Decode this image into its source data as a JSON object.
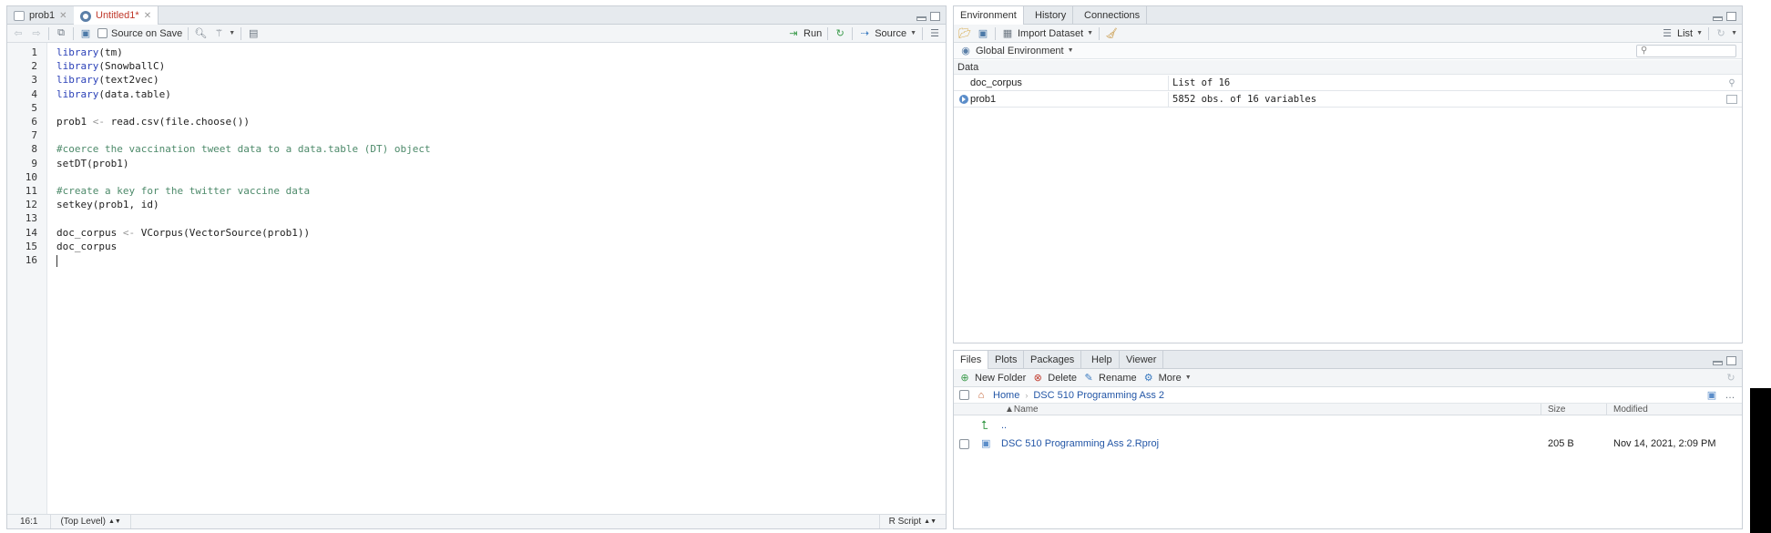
{
  "source": {
    "tabs": [
      {
        "label": "prob1",
        "modified": false
      },
      {
        "label": "Untitled1*",
        "modified": true
      }
    ],
    "toolbar": {
      "source_on_save": "Source on Save",
      "run": "Run",
      "source": "Source"
    },
    "lines": [
      {
        "num": "1",
        "parts": [
          {
            "t": "library",
            "c": "kw"
          },
          {
            "t": "(tm)",
            "c": ""
          }
        ]
      },
      {
        "num": "2",
        "parts": [
          {
            "t": "library",
            "c": "kw"
          },
          {
            "t": "(SnowballC)",
            "c": ""
          }
        ]
      },
      {
        "num": "3",
        "parts": [
          {
            "t": "library",
            "c": "kw"
          },
          {
            "t": "(text2vec)",
            "c": ""
          }
        ]
      },
      {
        "num": "4",
        "parts": [
          {
            "t": "library",
            "c": "kw"
          },
          {
            "t": "(data.table)",
            "c": ""
          }
        ]
      },
      {
        "num": "5",
        "parts": []
      },
      {
        "num": "6",
        "parts": [
          {
            "t": "prob1 ",
            "c": ""
          },
          {
            "t": "<-",
            "c": "op"
          },
          {
            "t": " read.csv(file.choose())",
            "c": ""
          }
        ]
      },
      {
        "num": "7",
        "parts": []
      },
      {
        "num": "8",
        "parts": [
          {
            "t": "#coerce the vaccination tweet data to a data.table (DT) object",
            "c": "cm"
          }
        ]
      },
      {
        "num": "9",
        "parts": [
          {
            "t": "setDT(prob1)",
            "c": ""
          }
        ]
      },
      {
        "num": "10",
        "parts": []
      },
      {
        "num": "11",
        "parts": [
          {
            "t": "#create a key for the twitter vaccine data",
            "c": "cm"
          }
        ]
      },
      {
        "num": "12",
        "parts": [
          {
            "t": "setkey(prob1, id)",
            "c": ""
          }
        ]
      },
      {
        "num": "13",
        "parts": []
      },
      {
        "num": "14",
        "parts": [
          {
            "t": "doc_corpus ",
            "c": ""
          },
          {
            "t": "<-",
            "c": "op"
          },
          {
            "t": " VCorpus(VectorSource(prob1))",
            "c": ""
          }
        ]
      },
      {
        "num": "15",
        "parts": [
          {
            "t": "doc_corpus",
            "c": ""
          }
        ]
      },
      {
        "num": "16",
        "parts": []
      }
    ],
    "status": {
      "position": "16:1",
      "scope": "(Top Level)",
      "filetype": "R Script"
    }
  },
  "environment": {
    "tabs": [
      "Environment",
      "History",
      "Connections"
    ],
    "import_dataset": "Import Dataset",
    "list_mode": "List",
    "scope": "Global Environment",
    "section": "Data",
    "rows": [
      {
        "name": "doc_corpus",
        "value": "List of 16",
        "expandable": false
      },
      {
        "name": "prob1",
        "value": "5852 obs. of 16 variables",
        "expandable": true
      }
    ]
  },
  "files": {
    "tabs": [
      "Files",
      "Plots",
      "Packages",
      "Help",
      "Viewer"
    ],
    "toolbar": {
      "new_folder": "New Folder",
      "delete": "Delete",
      "rename": "Rename",
      "more": "More"
    },
    "breadcrumb": [
      "Home",
      "DSC 510 Programming Ass 2"
    ],
    "columns": {
      "name": "Name",
      "size": "Size",
      "modified": "Modified"
    },
    "parent": "..",
    "rows": [
      {
        "name": "DSC 510 Programming Ass 2.Rproj",
        "size": "205 B",
        "modified": "Nov 14, 2021, 2:09 PM"
      }
    ]
  }
}
